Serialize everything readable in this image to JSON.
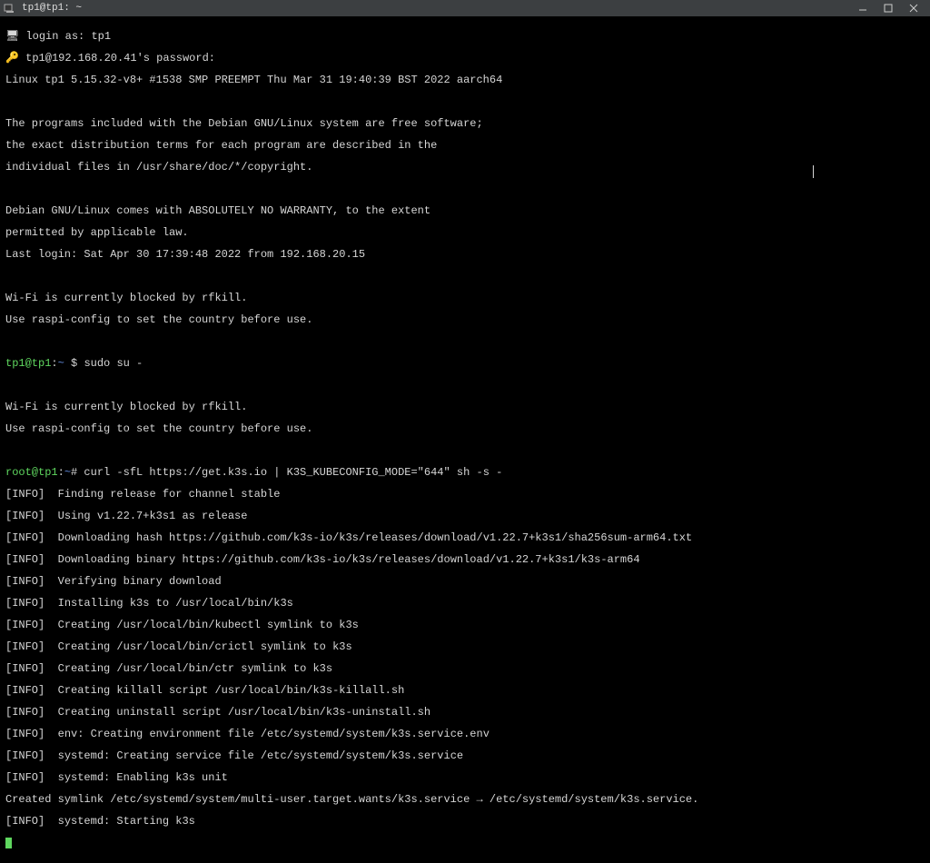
{
  "window": {
    "title": "tp1@tp1: ~"
  },
  "session": {
    "login_prompt": "login as: tp1",
    "password_prompt": "tp1@192.168.20.41's password:",
    "banner": "Linux tp1 5.15.32-v8+ #1538 SMP PREEMPT Thu Mar 31 19:40:39 BST 2022 aarch64",
    "motd1": "The programs included with the Debian GNU/Linux system are free software;",
    "motd2": "the exact distribution terms for each program are described in the",
    "motd3": "individual files in /usr/share/doc/*/copyright.",
    "motd4": "Debian GNU/Linux comes with ABSOLUTELY NO WARRANTY, to the extent",
    "motd5": "permitted by applicable law.",
    "last_login": "Last login: Sat Apr 30 17:39:48 2022 from 192.168.20.15",
    "rfkill1": "Wi-Fi is currently blocked by rfkill.",
    "rfkill2": "Use raspi-config to set the country before use."
  },
  "prompt1": {
    "user": "tp1@tp1",
    "path": "~",
    "sep": ":",
    "dollar": " $ ",
    "cmd": "sudo su -"
  },
  "rfkill2a": "Wi-Fi is currently blocked by rfkill.",
  "rfkill2b": "Use raspi-config to set the country before use.",
  "prompt2": {
    "user": "root@tp1",
    "path": "~",
    "sep": ":",
    "hash": "# ",
    "cmd": "curl -sfL https://get.k3s.io | K3S_KUBECONFIG_MODE=\"644\" sh -s -"
  },
  "info_tag": "[INFO]",
  "info": {
    "l1": "  Finding release for channel stable",
    "l2": "  Using v1.22.7+k3s1 as release",
    "l3": "  Downloading hash https://github.com/k3s-io/k3s/releases/download/v1.22.7+k3s1/sha256sum-arm64.txt",
    "l4": "  Downloading binary https://github.com/k3s-io/k3s/releases/download/v1.22.7+k3s1/k3s-arm64",
    "l5": "  Verifying binary download",
    "l6": "  Installing k3s to /usr/local/bin/k3s",
    "l7": "  Creating /usr/local/bin/kubectl symlink to k3s",
    "l8": "  Creating /usr/local/bin/crictl symlink to k3s",
    "l9": "  Creating /usr/local/bin/ctr symlink to k3s",
    "l10": "  Creating killall script /usr/local/bin/k3s-killall.sh",
    "l11": "  Creating uninstall script /usr/local/bin/k3s-uninstall.sh",
    "l12": "  env: Creating environment file /etc/systemd/system/k3s.service.env",
    "l13": "  systemd: Creating service file /etc/systemd/system/k3s.service",
    "l14": "  systemd: Enabling k3s unit",
    "l16": "  systemd: Starting k3s"
  },
  "symlink_line": "Created symlink /etc/systemd/system/multi-user.target.wants/k3s.service → /etc/systemd/system/k3s.service."
}
